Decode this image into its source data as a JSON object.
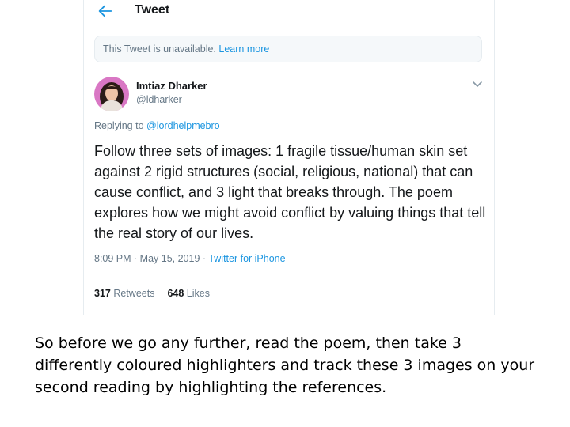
{
  "header": {
    "title": "Tweet",
    "back_icon": "arrow-left-icon"
  },
  "notice": {
    "text": "This Tweet is unavailable.",
    "link": "Learn more"
  },
  "author": {
    "name": "Imtiaz Dharker",
    "handle": "@ldharker",
    "avatar_icon": "avatar-photo"
  },
  "menu_icon": "chevron-down-icon",
  "reply": {
    "prefix": "Replying to",
    "mention": "@lordhelpmebro"
  },
  "tweet": {
    "text": "Follow three sets of images: 1 fragile tissue/human skin set against 2 rigid structures (social, religious, national) that can cause conflict, and 3 light that breaks through. The poem explores how we might avoid conflict by valuing things that tell the real story of our lives."
  },
  "meta": {
    "time": "8:09 PM",
    "date": "May 15, 2019",
    "source": "Twitter for iPhone"
  },
  "stats": {
    "retweets_count": "317",
    "retweets_label": "Retweets",
    "likes_count": "648",
    "likes_label": "Likes"
  },
  "caption": "So before we go any further, read the poem, then take 3 differently coloured highlighters and track these 3 images on your second reading by highlighting the references.",
  "colors": {
    "accent": "#1b95e0",
    "muted": "#657786",
    "text": "#14171a",
    "notice_bg": "#f5f8fa",
    "border": "#e6ecf0"
  }
}
